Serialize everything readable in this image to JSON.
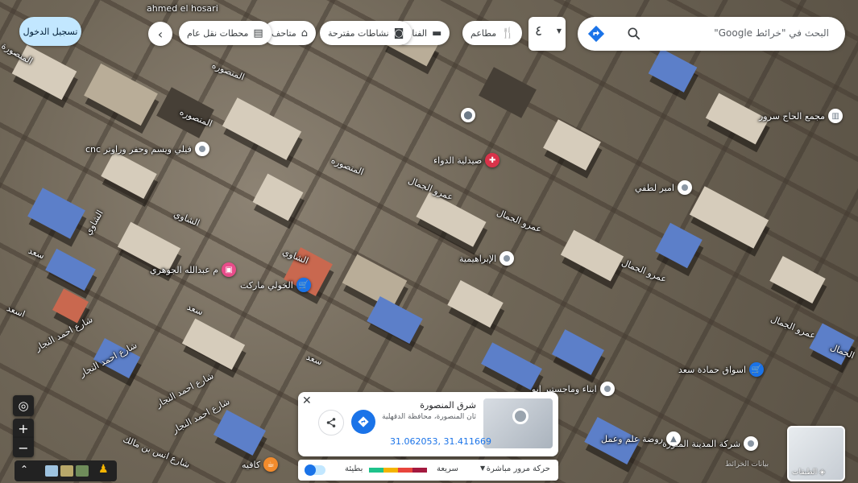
{
  "search": {
    "placeholder": "البحث في \"خرائط Google\""
  },
  "trip_control": {
    "label": "٤"
  },
  "categories": [
    {
      "label": "مطاعم",
      "icon": "restaurant-icon"
    },
    {
      "label": "الفنادق",
      "icon": "hotel-icon"
    },
    {
      "label": "نشاطات مقترحة",
      "icon": "camera-icon"
    },
    {
      "label": "متاحف",
      "icon": "museum-icon"
    },
    {
      "label": "محطات نقل عام",
      "icon": "transit-icon"
    }
  ],
  "sign_in": {
    "label": "تسجيل الدخول"
  },
  "map_labels": {
    "ahmed_alhusari": "ahmed el hosari",
    "almansoura_1": "المنصوره",
    "almansoura_2": "المنصوره",
    "almansoura_3": "المنصوره",
    "almansoura_4": "المنصورة",
    "amr_aljamal_1": "عمرو الجمال",
    "amr_aljamal_2": "عمرو الجمال",
    "amr_aljamal_3": "عمرو الجمال",
    "amr_aljamal_4": "عمرو الجمال",
    "alshawi_1": "الشاوي",
    "alshawi_2": "الشاوي",
    "alshawi_3": "الشاوي",
    "saad_1": "سعد",
    "saad_2": "سعد",
    "saad_3": "سعد",
    "saad_4": "اسعد",
    "ahmed_najjar_1": "شارع احمد النجار",
    "ahmed_najjar_2": "شارع احمد النجار",
    "ahmed_najjar_3": "شارع احمد النجار",
    "ahmed_najjar_4": "شارع احمد النجار",
    "anas_bin_malik": "شارع انس بن مالك",
    "aljamal_right": "الجمال"
  },
  "pois": [
    {
      "name": "مجمع الحاج سرور",
      "type": "landmark"
    },
    {
      "name": "صيدلية الدواء",
      "type": "pharmacy"
    },
    {
      "name": "امير لطفي",
      "type": "place"
    },
    {
      "name": "الإبراهيمية",
      "type": "place"
    },
    {
      "name": "فيلي ويسم وحفر وراوتر cnc",
      "type": "place"
    },
    {
      "name": "الخولي ماركت",
      "type": "store"
    },
    {
      "name": "م عبدالله الجوهري",
      "type": "shop"
    },
    {
      "name": "اسواق حمادة سعد",
      "type": "store"
    },
    {
      "name": "ابناء وماجستير ابو",
      "type": "place"
    },
    {
      "name": "شركة المدينة المنورة",
      "type": "place"
    },
    {
      "name": "روضة علم وعمل",
      "type": "place"
    },
    {
      "name": "كافيه",
      "type": "cafe"
    }
  ],
  "place_card": {
    "title": "شرق المنصورة",
    "address": "ثان المنصورة، محافظة الدقهلية",
    "coords": "31.062053, 31.411669"
  },
  "traffic": {
    "label": "حركة مرور مباشرة",
    "fast": "سريعة",
    "slow": "بطيئة",
    "colors": [
      "#1ec28b",
      "#f4b400",
      "#e8453c",
      "#a3193f"
    ]
  },
  "layers": {
    "label": "الطبقات"
  },
  "footer": {
    "text": "‏بيانات الخرائط"
  },
  "colors": {
    "accent": "#1a73e8",
    "signin_bg": "#c2e7ff"
  }
}
